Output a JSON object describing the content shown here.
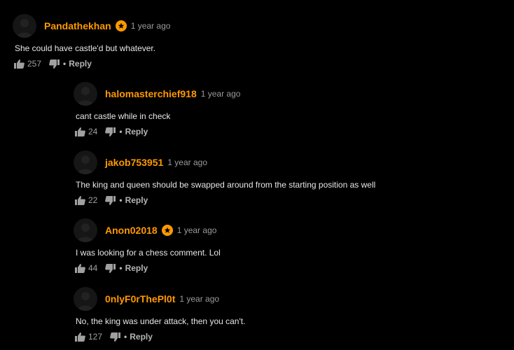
{
  "comments": [
    {
      "username": "Pandathekhan",
      "badge": true,
      "time": "1 year ago",
      "text": "She could have castle'd but whatever.",
      "likes": "257",
      "reply_label": "Reply"
    },
    {
      "username": "halomasterchief918",
      "badge": false,
      "time": "1 year ago",
      "text": "cant castle while in check",
      "likes": "24",
      "reply_label": "Reply"
    },
    {
      "username": "jakob753951",
      "badge": false,
      "time": "1 year ago",
      "text": "The king and queen should be swapped around from the starting position as well",
      "likes": "22",
      "reply_label": "Reply"
    },
    {
      "username": "Anon02018",
      "badge": true,
      "time": "1 year ago",
      "text": "I was looking for a chess comment. Lol",
      "likes": "44",
      "reply_label": "Reply"
    },
    {
      "username": "0nlyF0rThePl0t",
      "badge": false,
      "time": "1 year ago",
      "text": "No, the king was under attack, then you can't.",
      "likes": "127",
      "reply_label": "Reply"
    }
  ],
  "separator": "•",
  "icons": {
    "thumbs_up": "thumbs-up-icon",
    "thumbs_down": "thumbs-down-icon",
    "badge": "star-badge-icon",
    "avatar": "user-silhouette-icon"
  },
  "colors": {
    "background": "#000000",
    "username": "#ff9900",
    "text": "#e6e6e6",
    "meta": "#9a9a9a"
  }
}
